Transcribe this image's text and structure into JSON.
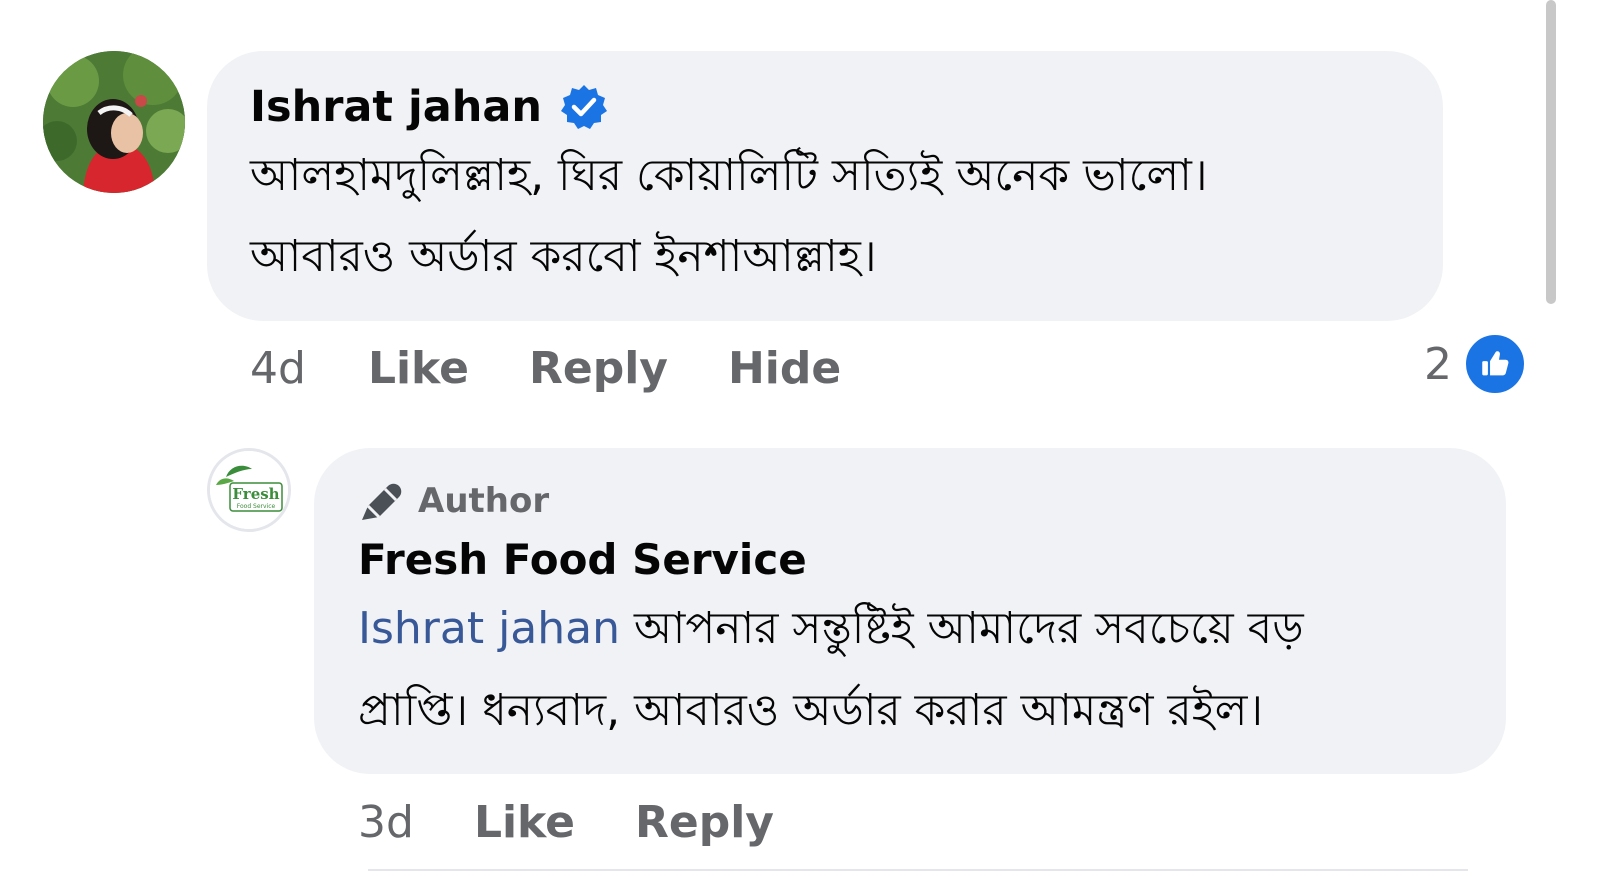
{
  "comment": {
    "author": "Ishrat jahan",
    "verified_icon": "verified-badge-icon",
    "text_line_1": "আলহামদুলিল্লাহ, ঘির কোয়ালিটি সত্যিই অনেক ভালো।",
    "text_line_2": "আবারও অর্ডার করবো ইনশাআল্লাহ।",
    "time": "4d",
    "like_label": "Like",
    "reply_label": "Reply",
    "hide_label": "Hide",
    "reaction_count": "2",
    "reaction_icon": "thumbs-up-icon"
  },
  "reply": {
    "badge_icon": "pen-icon",
    "badge_label": "Author",
    "author": "Fresh Food Service",
    "mention": "Ishrat jahan",
    "text_line_1": "আপনার সন্তুষ্টিই আমাদের সবচেয়ে বড়",
    "text_line_2": "প্রাপ্তি। ধন্যবাদ, আবারও অর্ডার করার আমন্ত্রণ রইল।",
    "time": "3d",
    "like_label": "Like",
    "reply_label": "Reply",
    "avatar_logo_text": "Fresh",
    "avatar_logo_subtext": "Food Service"
  },
  "colors": {
    "bubble": "#f0f2f5",
    "meta_text": "#65676b",
    "mention": "#385898",
    "like_blue": "#1b74e4",
    "logo_green": "#3a8d3a"
  }
}
